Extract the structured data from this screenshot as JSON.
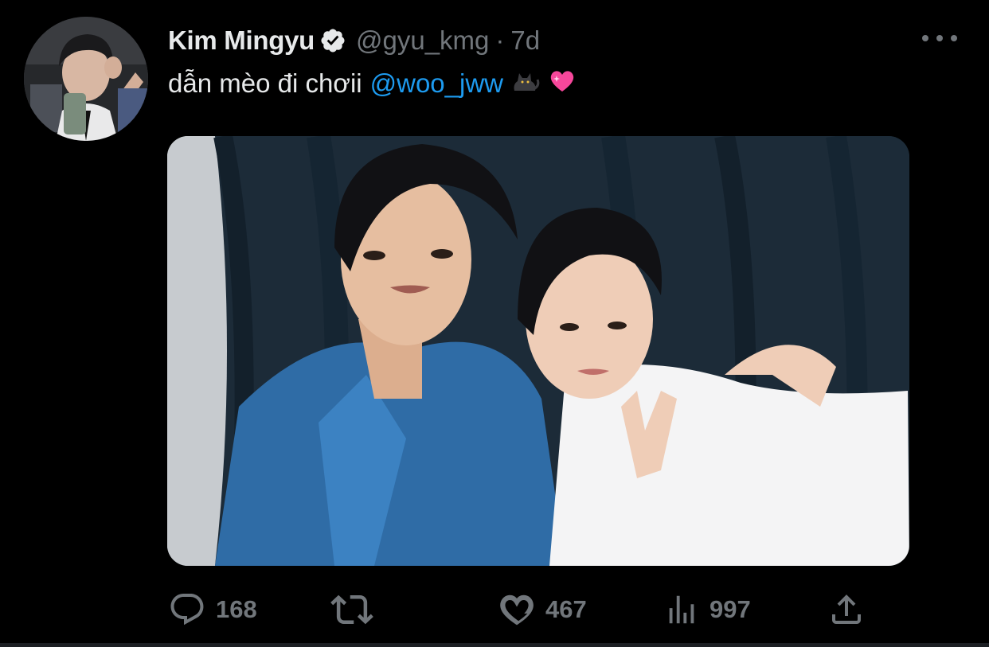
{
  "author": {
    "display_name": "Kim Mingyu",
    "handle": "@gyu_kmg",
    "separator": "·",
    "time": "7d",
    "verified": true
  },
  "tweet": {
    "text": "dẫn mèo đi chơii",
    "mention": "@woo_jww",
    "emojis": [
      "black-cat",
      "sparkling-heart"
    ]
  },
  "actions": {
    "replies": "168",
    "retweets": "",
    "likes": "467",
    "views": "997"
  },
  "icons": [
    "verified-badge-icon",
    "more-icon",
    "reply-icon",
    "retweet-icon",
    "like-icon",
    "views-icon",
    "share-icon"
  ],
  "colors": {
    "background": "#000000",
    "text": "#e7e9ea",
    "secondary": "#71767b",
    "link": "#1d9bf0",
    "heart": "#f7479b"
  }
}
